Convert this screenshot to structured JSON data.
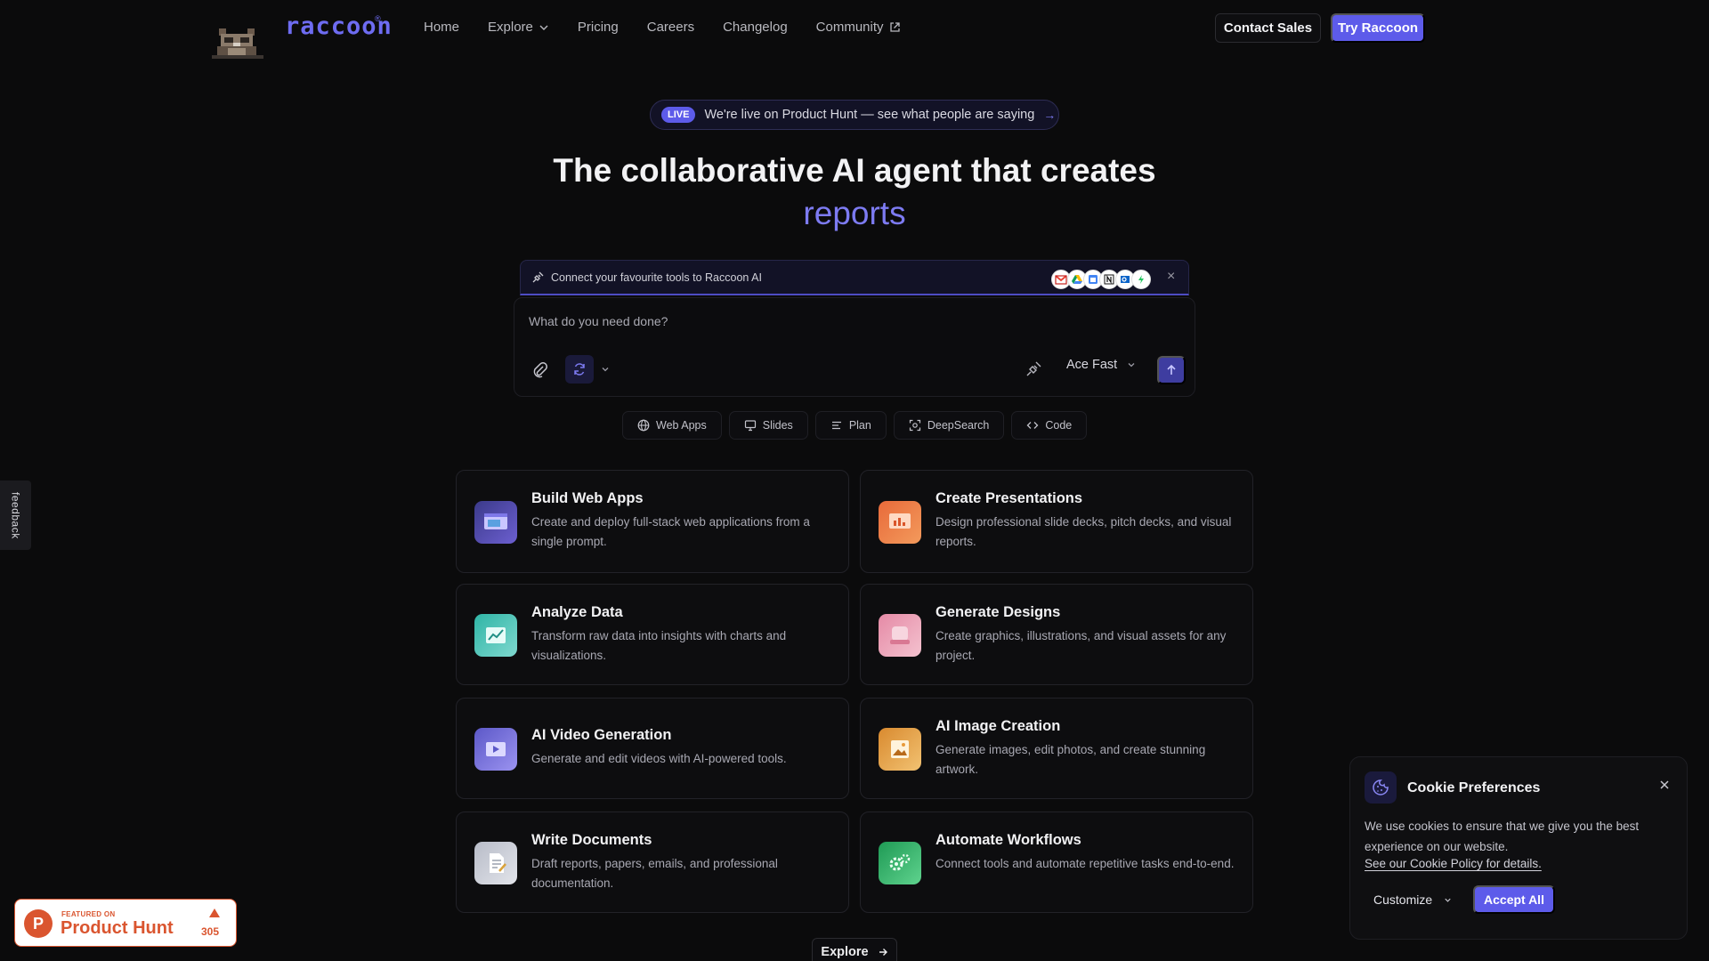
{
  "brand": {
    "name": "raccoon",
    "reg_mark": "®",
    "mascot_icon": "raccoon-mascot-icon"
  },
  "nav": {
    "links": [
      "Home",
      "Explore",
      "Pricing",
      "Careers",
      "Changelog",
      "Community"
    ],
    "contact_sales": "Contact Sales",
    "try": "Try Raccoon"
  },
  "announcement": {
    "badge": "LIVE",
    "text": "We're live on Product Hunt — see what people are saying",
    "arrow": "→"
  },
  "hero": {
    "title": "The collaborative AI agent that creates",
    "accent": "reports"
  },
  "connect": {
    "text": "Connect your favourite tools to Raccoon AI",
    "tool_icons": [
      "gmail-icon",
      "google-drive-icon",
      "calendar-icon",
      "notion-icon",
      "outlook-icon",
      "extra-tool-icon"
    ],
    "close": "×"
  },
  "prompt": {
    "placeholder": "What do you need done?",
    "model": "Ace Fast"
  },
  "quick_actions": [
    {
      "label": "Web Apps",
      "icon": "globe-icon"
    },
    {
      "label": "Slides",
      "icon": "monitor-icon"
    },
    {
      "label": "Plan",
      "icon": "list-icon"
    },
    {
      "label": "DeepSearch",
      "icon": "scan-icon"
    },
    {
      "label": "Code",
      "icon": "code-icon"
    }
  ],
  "cards": [
    {
      "title": "Build Web Apps",
      "desc": "Create and deploy full-stack web applications from a single prompt.",
      "icon": "web-app-icon"
    },
    {
      "title": "Create Presentations",
      "desc": "Design professional slide decks, pitch decks, and visual reports.",
      "icon": "presentation-icon"
    },
    {
      "title": "Analyze Data",
      "desc": "Transform raw data into insights with charts and visualizations.",
      "icon": "data-chart-icon"
    },
    {
      "title": "Generate Designs",
      "desc": "Create graphics, illustrations, and visual assets for any project.",
      "icon": "design-icon"
    },
    {
      "title": "AI Video Generation",
      "desc": "Generate and edit videos with AI-powered tools.",
      "icon": "video-icon"
    },
    {
      "title": "AI Image Creation",
      "desc": "Generate images, edit photos, and create stunning artwork.",
      "icon": "image-icon"
    },
    {
      "title": "Write Documents",
      "desc": "Draft reports, papers, emails, and professional documentation.",
      "icon": "document-icon"
    },
    {
      "title": "Automate Workflows",
      "desc": "Connect tools and automate repetitive tasks end-to-end.",
      "icon": "workflow-icon"
    }
  ],
  "explore_button": "Explore",
  "feedback": "feedback",
  "product_hunt": {
    "featured": "FEATURED ON",
    "name": "Product Hunt",
    "count": "305"
  },
  "cookie": {
    "title": "Cookie Preferences",
    "text": "We use cookies to ensure that we give you the best experience on our website.",
    "link": "See our Cookie Policy for details.",
    "customize": "Customize",
    "accept": "Accept All"
  },
  "colors": {
    "background": "#0b0b0c",
    "accent": "#5d5bea",
    "accent_text": "#7d7bf2",
    "product_hunt": "#da552f"
  }
}
